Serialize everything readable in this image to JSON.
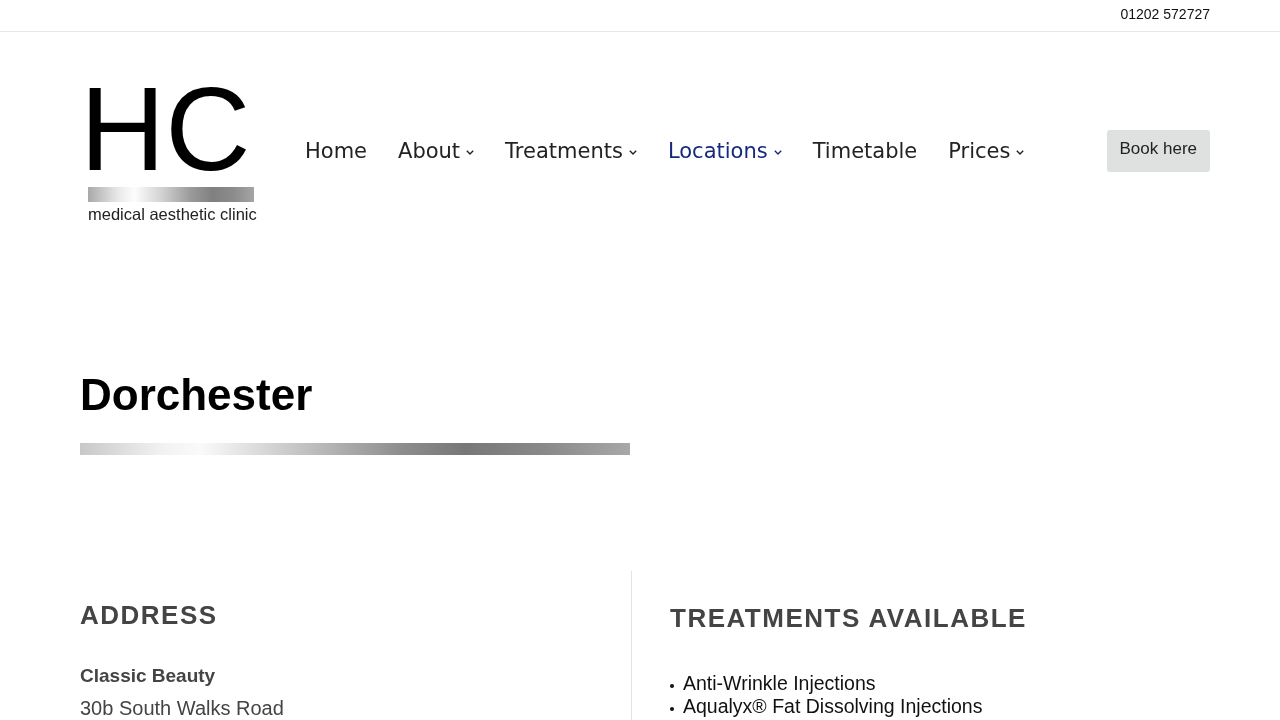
{
  "top_bar": {
    "phone": "01202 572727"
  },
  "header": {
    "logo": {
      "letters": "HC",
      "tagline": "medical aesthetic clinic"
    },
    "nav": [
      {
        "label": "Home",
        "has_dropdown": false,
        "selected": false
      },
      {
        "label": "About",
        "has_dropdown": true,
        "selected": false
      },
      {
        "label": "Treatments",
        "has_dropdown": true,
        "selected": false
      },
      {
        "label": "Locations",
        "has_dropdown": true,
        "selected": true
      },
      {
        "label": "Timetable",
        "has_dropdown": false,
        "selected": false
      },
      {
        "label": "Prices",
        "has_dropdown": true,
        "selected": false
      }
    ],
    "book_button": "Book here"
  },
  "page_title": "Dorchester",
  "address": {
    "heading": "ADDRESS",
    "name": "Classic Beauty",
    "lines": [
      "30b South Walks Road"
    ]
  },
  "treatments": {
    "heading": "TREATMENTS AVAILABLE",
    "items": [
      "Anti-Wrinkle Injections",
      "Aqualyx® Fat Dissolving Injections"
    ]
  }
}
